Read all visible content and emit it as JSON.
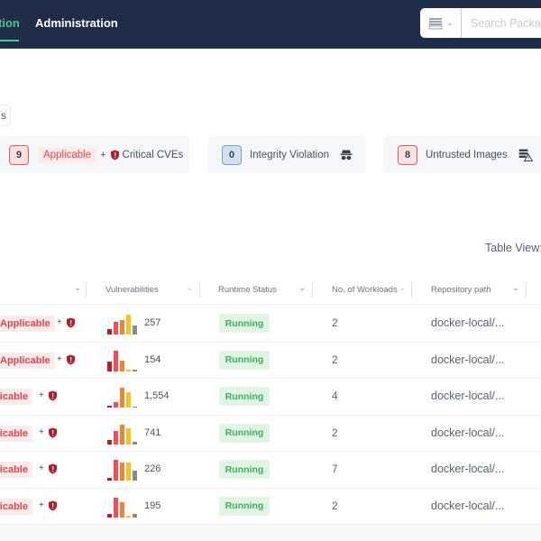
{
  "nav": {
    "tabs": [
      {
        "label": "tion",
        "active": true
      },
      {
        "label": "Administration",
        "active": false
      }
    ],
    "repo_selector_icon": "package-registry-icon",
    "search_placeholder": "Search Packages"
  },
  "filter_chip": {
    "label": "s"
  },
  "summary": {
    "cards": [
      {
        "count": "9",
        "tag": "Applicable",
        "plus": "+",
        "label": "Critical CVEs",
        "icon": "shield-alert-icon",
        "color": "#e15a5f"
      },
      {
        "count": "0",
        "label": "Integrity Violation",
        "icon": "spy-icon",
        "color": "#7f9cc4"
      },
      {
        "count": "8",
        "label": "Untrusted Images",
        "icon": "database-warning-icon",
        "color": "#e15a5f"
      }
    ]
  },
  "table_view_label": "Table View:",
  "table": {
    "columns": [
      {
        "label": ""
      },
      {
        "label": "Vulnerabilities"
      },
      {
        "label": "Runtime Status"
      },
      {
        "label": "No. of Workloads"
      },
      {
        "label": "Repository path"
      }
    ],
    "severity_colors": [
      "#b3202b",
      "#ef4f5a",
      "#f0823a",
      "#f8c21c",
      "#8c8c8c"
    ],
    "rows": [
      {
        "tag": "Applicable",
        "plus": "+",
        "severity": [
          0.25,
          0.6,
          0.7,
          0.95,
          0.45
        ],
        "vulnerabilities": "257",
        "status": "Running",
        "workloads": "2",
        "repo_path": "docker-local/..."
      },
      {
        "tag": "Applicable",
        "plus": "+",
        "severity": [
          0.45,
          1.0,
          0.5,
          0.05,
          0.05
        ],
        "vulnerabilities": "154",
        "status": "Running",
        "workloads": "2",
        "repo_path": "docker-local/..."
      },
      {
        "tag": "plicable",
        "plus": "+",
        "severity": [
          0.08,
          0.25,
          0.95,
          0.75,
          0.03
        ],
        "vulnerabilities": "1,554",
        "status": "Running",
        "workloads": "4",
        "repo_path": "docker-local/..."
      },
      {
        "tag": "plicable",
        "plus": "+",
        "severity": [
          0.2,
          0.65,
          0.95,
          0.75,
          0.1
        ],
        "vulnerabilities": "741",
        "status": "Running",
        "workloads": "2",
        "repo_path": "docker-local/..."
      },
      {
        "tag": "plicable",
        "plus": "+",
        "severity": [
          0.15,
          1.0,
          0.85,
          0.85,
          0.5
        ],
        "vulnerabilities": "226",
        "status": "Running",
        "workloads": "7",
        "repo_path": "docker-local/..."
      },
      {
        "tag": "plicable",
        "plus": "+",
        "severity": [
          0.15,
          0.95,
          0.7,
          0.03,
          0.15
        ],
        "vulnerabilities": "195",
        "status": "Running",
        "workloads": "2",
        "repo_path": "docker-local/..."
      }
    ]
  }
}
